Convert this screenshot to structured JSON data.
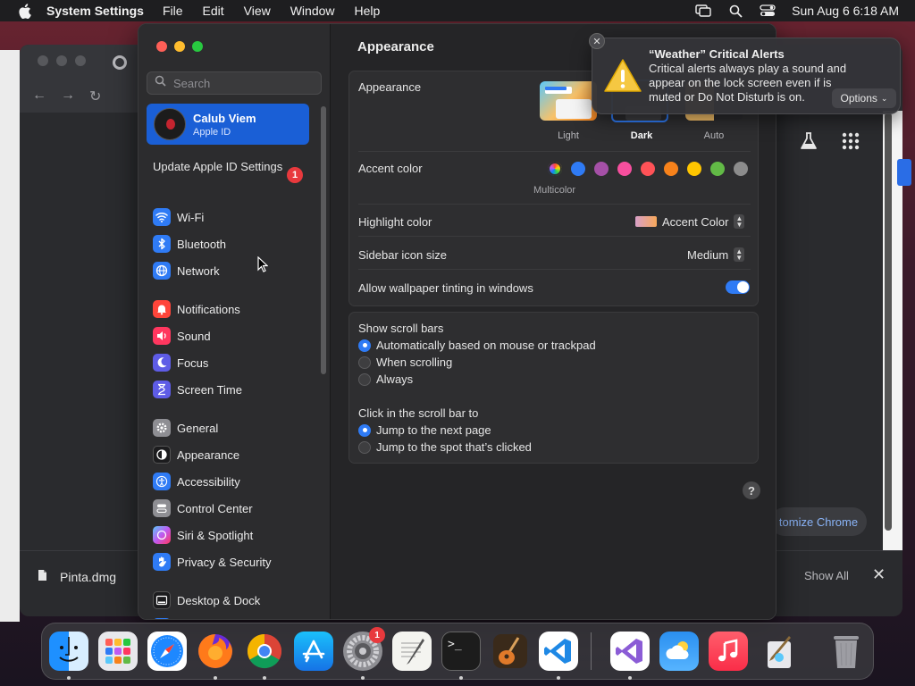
{
  "menubar": {
    "app_name": "System Settings",
    "menus": [
      "File",
      "Edit",
      "View",
      "Window",
      "Help"
    ],
    "clock": "Sun Aug 6  6:18 AM"
  },
  "browser": {
    "customize_label": "tomize Chrome",
    "download_file": "Pinta.dmg",
    "show_all": "Show All"
  },
  "sidebar": {
    "search_placeholder": "Search",
    "account_name": "Calub Viem",
    "account_sub": "Apple ID",
    "update_text": "Update Apple ID Settings",
    "update_badge": "1",
    "items": [
      {
        "label": "Wi-Fi",
        "icon": "wifi-icon",
        "color": "#2f7bf5"
      },
      {
        "label": "Bluetooth",
        "icon": "bluetooth-icon",
        "color": "#2f7bf5"
      },
      {
        "label": "Network",
        "icon": "globe-icon",
        "color": "#2f7bf5"
      },
      {
        "label": "Notifications",
        "icon": "bell-icon",
        "color": "#ff453a"
      },
      {
        "label": "Sound",
        "icon": "speaker-icon",
        "color": "#ff375f"
      },
      {
        "label": "Focus",
        "icon": "moon-icon",
        "color": "#5e5ce6"
      },
      {
        "label": "Screen Time",
        "icon": "hourglass-icon",
        "color": "#5e5ce6"
      },
      {
        "label": "General",
        "icon": "gear-icon",
        "color": "#8e8e93"
      },
      {
        "label": "Appearance",
        "icon": "appearance-icon",
        "color": "#1c1c1e"
      },
      {
        "label": "Accessibility",
        "icon": "accessibility-icon",
        "color": "#2f7bf5"
      },
      {
        "label": "Control Center",
        "icon": "control-center-icon",
        "color": "#8e8e93"
      },
      {
        "label": "Siri & Spotlight",
        "icon": "siri-icon",
        "color": "#bf5af2"
      },
      {
        "label": "Privacy & Security",
        "icon": "hand-icon",
        "color": "#2f7bf5"
      },
      {
        "label": "Desktop & Dock",
        "icon": "dock-icon",
        "color": "#1c1c1e"
      }
    ]
  },
  "content": {
    "title": "Appearance",
    "appearance_label": "Appearance",
    "themes": [
      "Light",
      "Dark",
      "Auto"
    ],
    "accent_label": "Accent color",
    "accent_colors": [
      "#2f7bf5",
      "#a550a7",
      "#f74f9e",
      "#ff5257",
      "#f7821b",
      "#ffc600",
      "#62ba46",
      "#8c8c8c"
    ],
    "multicolor_label": "Multicolor",
    "highlight_label": "Highlight color",
    "highlight_value": "Accent Color",
    "icon_size_label": "Sidebar icon size",
    "icon_size_value": "Medium",
    "tinting_label": "Allow wallpaper tinting in windows",
    "scrollbars_label": "Show scroll bars",
    "scrollbar_options": [
      "Automatically based on mouse or trackpad",
      "When scrolling",
      "Always"
    ],
    "click_label": "Click in the scroll bar to",
    "click_options": [
      "Jump to the next page",
      "Jump to the spot that’s clicked"
    ],
    "help": "?"
  },
  "notification": {
    "title": "“Weather” Critical Alerts",
    "body": "Critical alerts always play a sound and appear on the lock screen even if is muted or Do Not Disturb is on.",
    "options": "Options"
  },
  "dock": {
    "badge": "1",
    "apps": [
      "finder-icon",
      "launchpad-icon",
      "safari-icon",
      "firefox-icon",
      "chrome-icon",
      "app-store-icon",
      "system-settings-icon",
      "textedit-icon",
      "terminal-icon",
      "garageband-icon",
      "vscode-icon",
      "visual-studio-icon",
      "weather-icon",
      "music-icon",
      "preview-icon",
      "trash-icon"
    ]
  }
}
